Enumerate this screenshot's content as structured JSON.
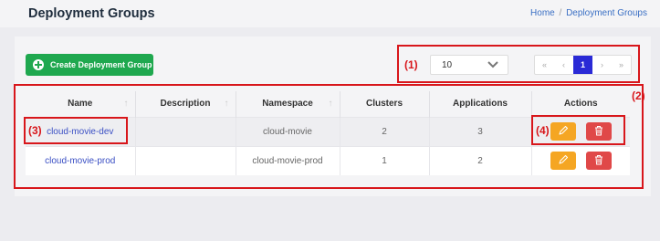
{
  "header": {
    "title": "Deployment Groups",
    "breadcrumb_home": "Home",
    "breadcrumb_sep": "/",
    "breadcrumb_current": "Deployment Groups"
  },
  "toolbar": {
    "create_label": "Create Deployment Group",
    "page_size": "10"
  },
  "pagination": {
    "first": "«",
    "prev": "‹",
    "current": "1",
    "next": "›",
    "last": "»"
  },
  "table": {
    "columns": [
      "Name",
      "Description",
      "Namespace",
      "Clusters",
      "Applications",
      "Actions"
    ],
    "sort_icon": "↑",
    "rows": [
      {
        "name": "cloud-movie-dev",
        "description": "",
        "namespace": "cloud-movie",
        "clusters": "2",
        "applications": "3"
      },
      {
        "name": "cloud-movie-prod",
        "description": "",
        "namespace": "cloud-movie-prod",
        "clusters": "1",
        "applications": "2"
      }
    ]
  },
  "annotations": {
    "a1": "(1)",
    "a2": "(2)",
    "a3": "(3)",
    "a4": "(4)",
    "color": "#d8161b"
  },
  "colors": {
    "create_button": "#1fa84f",
    "page_active": "#2a2ad6",
    "edit_button": "#f5a623",
    "delete_button": "#e04848"
  },
  "icons": [
    "plus-circle-icon",
    "chevron-down-icon",
    "sort-icon",
    "pencil-icon",
    "trash-icon"
  ]
}
